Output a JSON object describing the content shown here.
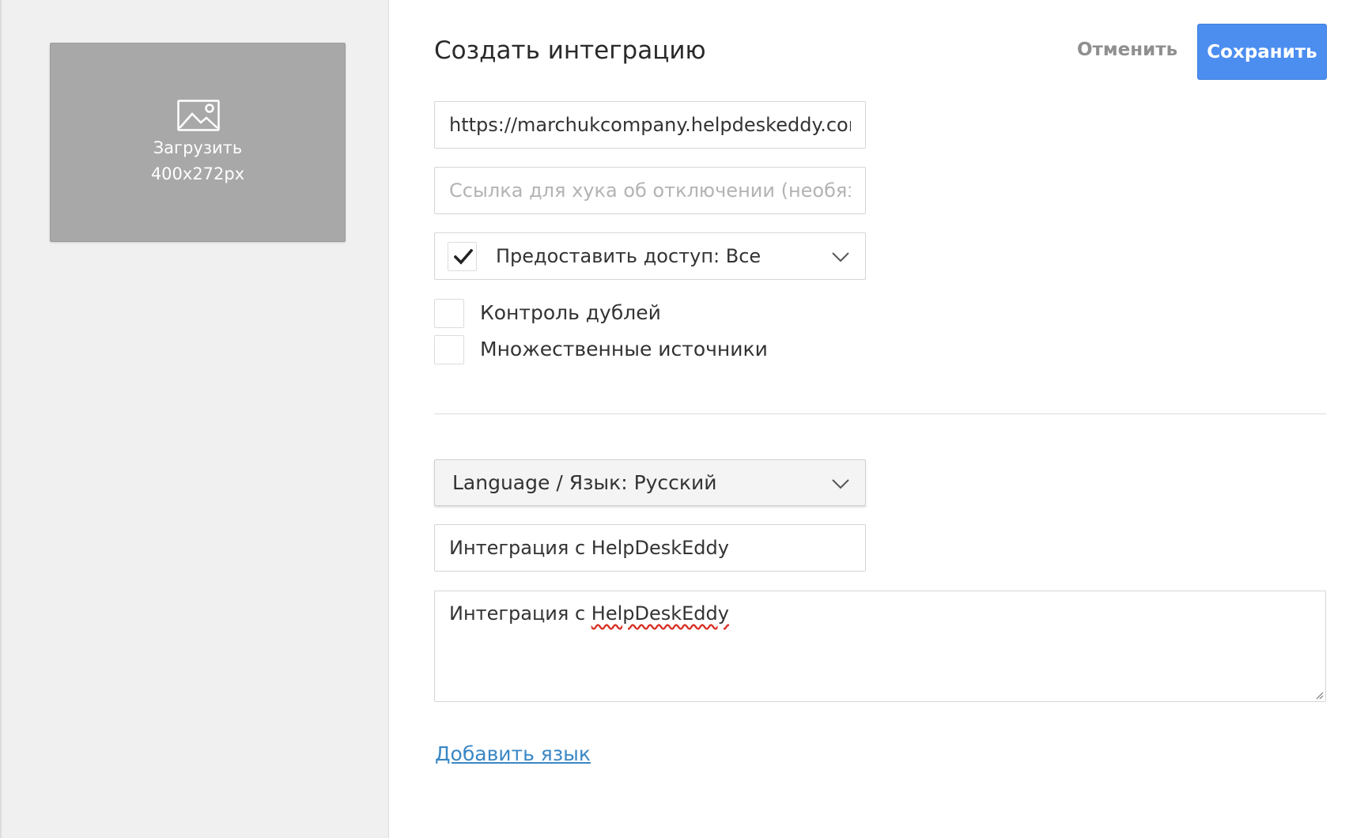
{
  "upload": {
    "label": "Загрузить",
    "size": "400x272px",
    "icon": "image-icon"
  },
  "header": {
    "title": "Создать интеграцию",
    "cancel_label": "Отменить",
    "save_label": "Сохранить"
  },
  "form": {
    "url_value": "https://marchukcompany.helpdeskeddy.cor",
    "hook_placeholder": "Ссылка для хука об отключении (необяза",
    "access": {
      "label": "Предоставить доступ: Все",
      "checked": true
    },
    "duplicates": {
      "label": "Контроль дублей",
      "checked": false
    },
    "multiple_sources": {
      "label": "Множественные источники",
      "checked": false
    },
    "language": {
      "label": "Language / Язык: Русский"
    },
    "name_value": "Интеграция с HelpDeskEddy",
    "description": {
      "prefix": "Интеграция с ",
      "misspelled": "HelpDeskEddy"
    },
    "add_language_label": "Добавить язык"
  },
  "colors": {
    "accent": "#4c8ef0",
    "link": "#3a87c4",
    "sidebar_bg": "#f0f0f0",
    "upload_bg": "#a8a8a8",
    "spellcheck": "#d93025"
  }
}
